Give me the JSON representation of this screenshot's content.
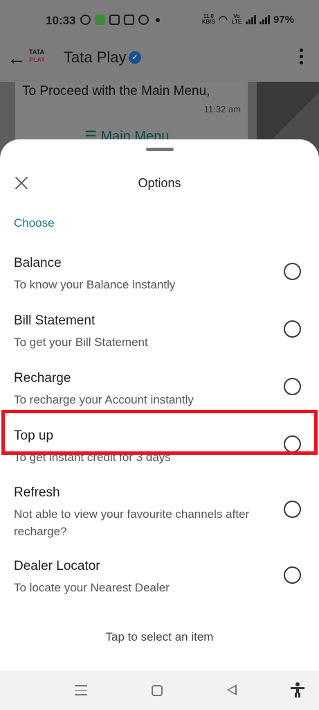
{
  "status_bar": {
    "time": "10:33",
    "net_speed_top": "11.0",
    "net_speed_bottom": "KB/S",
    "volte": "Vo LTE",
    "battery": "97%"
  },
  "chat_header": {
    "logo_top": "TATA",
    "logo_bottom": "PLAY",
    "title": "Tata Play",
    "verified_mark": "✓"
  },
  "chat": {
    "message_text": "To Proceed with the Main Menu,",
    "message_time": "11:32 am",
    "action_icon": "☰",
    "action_label": "Main Menu"
  },
  "sheet": {
    "title": "Options",
    "section_label": "Choose",
    "options": [
      {
        "title": "Balance",
        "desc": "To know your Balance instantly",
        "selected": false
      },
      {
        "title": "Bill Statement",
        "desc": "To get your Bill Statement",
        "selected": false
      },
      {
        "title": "Recharge",
        "desc": "To recharge your Account instantly",
        "selected": false
      },
      {
        "title": "Top up",
        "desc": "To get instant credit for 3 days",
        "selected": false
      },
      {
        "title": "Refresh",
        "desc": "Not able to view your favourite channels after recharge?",
        "selected": false
      },
      {
        "title": "Dealer Locator",
        "desc": "To locate your Nearest Dealer",
        "selected": false
      }
    ],
    "footer_hint": "Tap to select an item"
  },
  "colors": {
    "highlight": "#e5161d",
    "accent": "#207a8a",
    "verified": "#1a4f8f"
  }
}
